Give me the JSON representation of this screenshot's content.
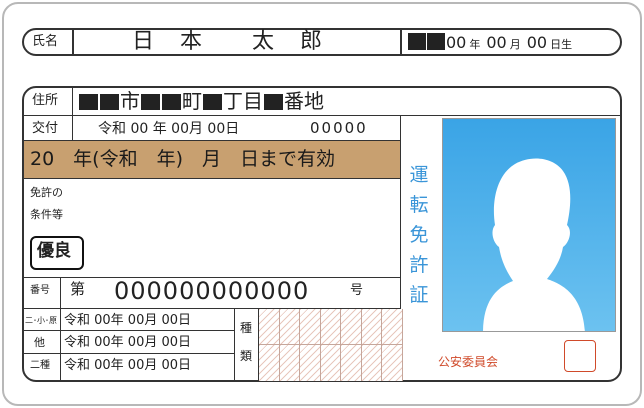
{
  "name_label": "氏名",
  "name_value": "日　本　　太　郎",
  "birth": {
    "y": "00",
    "y_unit": "年",
    "m": "00",
    "m_unit": "月",
    "d": "00",
    "d_unit": "日生"
  },
  "address_label": "住所",
  "address_parts": [
    "市",
    "町",
    "丁目",
    "番地"
  ],
  "issue_label": "交付",
  "issue_date": "令和 00 年 00月 00日",
  "issue_number": "00000",
  "expiry_text": "20　年(令和　年)　月　日まで有効",
  "conditions_label_1": "免許の",
  "conditions_label_2": "条件等",
  "yuryo_label": "優良",
  "number_label": "番号",
  "license_number_prefix": "第",
  "license_number": "000000000000",
  "license_number_suffix": "号",
  "category_rows": [
    {
      "label": "二･小･原",
      "date": "令和 00年 00月 00日"
    },
    {
      "label": "他",
      "date": "令和 00年 00月 00日"
    },
    {
      "label": "二種",
      "date": "令和 00年 00月 00日"
    }
  ],
  "kind_labels": [
    "種",
    "類"
  ],
  "license_title": [
    "運",
    "転",
    "免",
    "許",
    "証"
  ],
  "public_safety_commission": "公安委員会",
  "colors": {
    "expiry_band": "#c8a070",
    "title_blue": "#3a95d8",
    "photo_bg": "#4aaee8",
    "seal_red": "#d04a2a"
  }
}
